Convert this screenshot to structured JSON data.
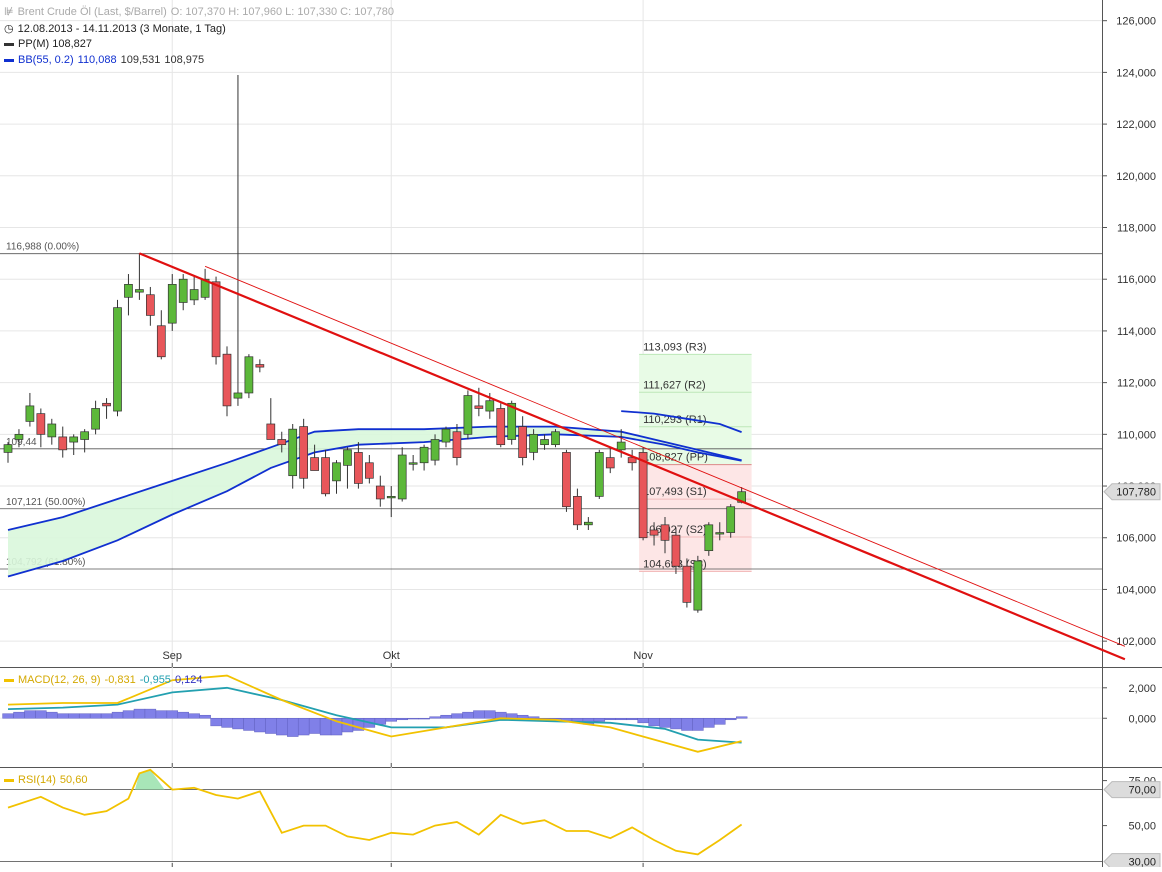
{
  "header": {
    "title": "Brent Crude Öl (Last, $/Barrel)",
    "ohlc": "O: 107,370  H: 107,960  L: 107,330  C: 107,780",
    "range": "12.08.2013 - 14.11.2013 (3 Monate, 1 Tag)",
    "pp_legend": "PP(M)  108,827",
    "bb_legend_name": "BB(55, 0.2)",
    "bb_legend_values": [
      "110,088",
      "109,531",
      "108,975"
    ]
  },
  "colors": {
    "up": "#5cb83a",
    "down": "#e8565a",
    "trend": "#e01010",
    "bb": "#1030d0",
    "bb_fill": "#d9f7dc",
    "macd": "#f2c200",
    "signal": "#23a0b0",
    "hist": "#8080e8",
    "rsi": "#f2c200",
    "pivot_r_fill": "#e8fbe6",
    "pivot_s_fill": "#fde6e6",
    "last_price_box": "#dcdcdc"
  },
  "chart_data": [
    {
      "type": "candlestick",
      "name": "Brent Crude Öl",
      "x_labels": [
        "Sep",
        "Okt",
        "Nov"
      ],
      "x_label_positions": [
        15,
        35,
        58
      ],
      "ylim": [
        101,
        126.8
      ],
      "y_ticks": [
        102,
        104,
        106,
        108,
        110,
        112,
        114,
        116,
        118,
        120,
        122,
        124,
        126
      ],
      "y_tick_labels": [
        "102,000",
        "104,000",
        "106,000",
        "108,000",
        "110,000",
        "112,000",
        "114,000",
        "116,000",
        "118,000",
        "120,000",
        "122,000",
        "124,000",
        "126,000"
      ],
      "last_price": 107.78,
      "last_price_label": "107,780",
      "candles": [
        {
          "i": 0,
          "o": 109.3,
          "h": 109.7,
          "l": 108.9,
          "c": 109.6
        },
        {
          "i": 1,
          "o": 109.8,
          "h": 110.2,
          "l": 109.5,
          "c": 110.0
        },
        {
          "i": 2,
          "o": 110.5,
          "h": 111.6,
          "l": 110.3,
          "c": 111.1
        },
        {
          "i": 3,
          "o": 110.8,
          "h": 111.0,
          "l": 109.5,
          "c": 110.0
        },
        {
          "i": 4,
          "o": 109.9,
          "h": 110.6,
          "l": 109.6,
          "c": 110.4
        },
        {
          "i": 5,
          "o": 109.9,
          "h": 110.3,
          "l": 109.1,
          "c": 109.4
        },
        {
          "i": 6,
          "o": 109.7,
          "h": 110.0,
          "l": 109.2,
          "c": 109.9
        },
        {
          "i": 7,
          "o": 109.8,
          "h": 110.2,
          "l": 109.3,
          "c": 110.1
        },
        {
          "i": 8,
          "o": 110.2,
          "h": 111.3,
          "l": 110.0,
          "c": 111.0
        },
        {
          "i": 9,
          "o": 111.2,
          "h": 111.4,
          "l": 110.6,
          "c": 111.1
        },
        {
          "i": 10,
          "o": 110.9,
          "h": 115.2,
          "l": 110.7,
          "c": 114.9
        },
        {
          "i": 11,
          "o": 115.3,
          "h": 116.2,
          "l": 114.6,
          "c": 115.8
        },
        {
          "i": 12,
          "o": 115.5,
          "h": 117.0,
          "l": 115.2,
          "c": 115.6
        },
        {
          "i": 13,
          "o": 115.4,
          "h": 115.7,
          "l": 114.2,
          "c": 114.6
        },
        {
          "i": 14,
          "o": 114.2,
          "h": 114.8,
          "l": 112.9,
          "c": 113.0
        },
        {
          "i": 15,
          "o": 114.3,
          "h": 116.2,
          "l": 114.0,
          "c": 115.8
        },
        {
          "i": 16,
          "o": 115.1,
          "h": 116.2,
          "l": 114.8,
          "c": 116.0
        },
        {
          "i": 17,
          "o": 115.2,
          "h": 116.1,
          "l": 115.0,
          "c": 115.6
        },
        {
          "i": 18,
          "o": 115.3,
          "h": 116.4,
          "l": 115.2,
          "c": 116.0
        },
        {
          "i": 19,
          "o": 115.9,
          "h": 116.1,
          "l": 112.7,
          "c": 113.0
        },
        {
          "i": 20,
          "o": 113.1,
          "h": 113.4,
          "l": 110.7,
          "c": 111.1
        },
        {
          "i": 21,
          "o": 111.4,
          "h": 123.9,
          "l": 111.1,
          "c": 111.6
        },
        {
          "i": 22,
          "o": 111.6,
          "h": 113.1,
          "l": 111.4,
          "c": 113.0
        },
        {
          "i": 23,
          "o": 112.7,
          "h": 112.9,
          "l": 112.4,
          "c": 112.6
        },
        {
          "i": 24,
          "o": 110.4,
          "h": 111.4,
          "l": 109.8,
          "c": 109.8
        },
        {
          "i": 25,
          "o": 109.8,
          "h": 110.1,
          "l": 109.3,
          "c": 109.6
        },
        {
          "i": 26,
          "o": 108.4,
          "h": 110.4,
          "l": 107.9,
          "c": 110.2
        },
        {
          "i": 27,
          "o": 110.3,
          "h": 110.6,
          "l": 107.9,
          "c": 108.3
        },
        {
          "i": 28,
          "o": 109.1,
          "h": 109.6,
          "l": 108.6,
          "c": 108.6
        },
        {
          "i": 29,
          "o": 109.1,
          "h": 109.4,
          "l": 107.6,
          "c": 107.7
        },
        {
          "i": 30,
          "o": 108.2,
          "h": 109.0,
          "l": 107.7,
          "c": 108.9
        },
        {
          "i": 31,
          "o": 108.8,
          "h": 109.5,
          "l": 107.9,
          "c": 109.4
        },
        {
          "i": 32,
          "o": 109.3,
          "h": 109.7,
          "l": 107.9,
          "c": 108.1
        },
        {
          "i": 33,
          "o": 108.9,
          "h": 109.2,
          "l": 108.1,
          "c": 108.3
        },
        {
          "i": 34,
          "o": 108.0,
          "h": 108.4,
          "l": 107.2,
          "c": 107.5
        },
        {
          "i": 35,
          "o": 107.6,
          "h": 108.0,
          "l": 106.8,
          "c": 107.6
        },
        {
          "i": 36,
          "o": 107.5,
          "h": 109.5,
          "l": 107.4,
          "c": 109.2
        },
        {
          "i": 37,
          "o": 108.9,
          "h": 109.2,
          "l": 108.6,
          "c": 108.9
        },
        {
          "i": 38,
          "o": 108.9,
          "h": 109.6,
          "l": 108.6,
          "c": 109.5
        },
        {
          "i": 39,
          "o": 109.0,
          "h": 110.0,
          "l": 108.8,
          "c": 109.8
        },
        {
          "i": 40,
          "o": 109.7,
          "h": 110.3,
          "l": 109.5,
          "c": 110.2
        },
        {
          "i": 41,
          "o": 110.1,
          "h": 110.4,
          "l": 108.8,
          "c": 109.1
        },
        {
          "i": 42,
          "o": 110.0,
          "h": 111.7,
          "l": 109.8,
          "c": 111.5
        },
        {
          "i": 43,
          "o": 111.1,
          "h": 111.8,
          "l": 110.7,
          "c": 111.0
        },
        {
          "i": 44,
          "o": 110.9,
          "h": 111.6,
          "l": 110.6,
          "c": 111.3
        },
        {
          "i": 45,
          "o": 111.0,
          "h": 111.2,
          "l": 109.5,
          "c": 109.6
        },
        {
          "i": 46,
          "o": 109.8,
          "h": 111.3,
          "l": 109.6,
          "c": 111.2
        },
        {
          "i": 47,
          "o": 110.3,
          "h": 110.7,
          "l": 108.8,
          "c": 109.1
        },
        {
          "i": 48,
          "o": 109.3,
          "h": 110.2,
          "l": 109.0,
          "c": 110.0
        },
        {
          "i": 49,
          "o": 109.6,
          "h": 110.0,
          "l": 109.4,
          "c": 109.8
        },
        {
          "i": 50,
          "o": 109.6,
          "h": 110.2,
          "l": 109.5,
          "c": 110.1
        },
        {
          "i": 51,
          "o": 109.3,
          "h": 109.4,
          "l": 107.0,
          "c": 107.2
        },
        {
          "i": 52,
          "o": 107.6,
          "h": 107.9,
          "l": 106.3,
          "c": 106.5
        },
        {
          "i": 53,
          "o": 106.5,
          "h": 106.8,
          "l": 106.3,
          "c": 106.6
        },
        {
          "i": 54,
          "o": 107.6,
          "h": 109.4,
          "l": 107.5,
          "c": 109.3
        },
        {
          "i": 55,
          "o": 109.1,
          "h": 109.5,
          "l": 108.5,
          "c": 108.7
        },
        {
          "i": 56,
          "o": 109.4,
          "h": 110.2,
          "l": 109.1,
          "c": 109.7
        },
        {
          "i": 57,
          "o": 109.1,
          "h": 109.4,
          "l": 108.6,
          "c": 108.9
        },
        {
          "i": 58,
          "o": 109.3,
          "h": 109.5,
          "l": 105.9,
          "c": 106.0
        },
        {
          "i": 59,
          "o": 106.3,
          "h": 106.6,
          "l": 105.7,
          "c": 106.1
        },
        {
          "i": 60,
          "o": 106.5,
          "h": 106.8,
          "l": 105.4,
          "c": 105.9
        },
        {
          "i": 61,
          "o": 106.1,
          "h": 106.4,
          "l": 104.6,
          "c": 104.9
        },
        {
          "i": 62,
          "o": 104.9,
          "h": 105.2,
          "l": 103.3,
          "c": 103.5
        },
        {
          "i": 63,
          "o": 103.2,
          "h": 105.3,
          "l": 103.1,
          "c": 105.1
        },
        {
          "i": 64,
          "o": 105.5,
          "h": 106.6,
          "l": 105.3,
          "c": 106.5
        },
        {
          "i": 65,
          "o": 106.2,
          "h": 106.6,
          "l": 105.9,
          "c": 106.2
        },
        {
          "i": 66,
          "o": 106.2,
          "h": 107.3,
          "l": 106.0,
          "c": 107.2
        },
        {
          "i": 67,
          "o": 107.37,
          "h": 107.96,
          "l": 107.33,
          "c": 107.78
        }
      ],
      "bollinger": {
        "upper": [
          [
            0,
            106.3
          ],
          [
            5,
            106.8
          ],
          [
            10,
            107.5
          ],
          [
            15,
            108.2
          ],
          [
            20,
            108.9
          ],
          [
            24,
            109.5
          ],
          [
            28,
            110.1
          ],
          [
            32,
            110.2
          ],
          [
            38,
            110.2
          ],
          [
            44,
            110.3
          ],
          [
            50,
            110.3
          ],
          [
            56,
            110.1
          ],
          [
            62,
            109.5
          ],
          [
            67,
            109.0
          ]
        ],
        "lower": [
          [
            0,
            104.5
          ],
          [
            5,
            105.1
          ],
          [
            10,
            105.9
          ],
          [
            15,
            106.9
          ],
          [
            20,
            107.8
          ],
          [
            24,
            108.7
          ],
          [
            28,
            109.3
          ],
          [
            32,
            109.6
          ],
          [
            38,
            109.7
          ],
          [
            44,
            109.9
          ],
          [
            50,
            110.0
          ],
          [
            56,
            109.9
          ],
          [
            60,
            109.6
          ],
          [
            63,
            109.3
          ],
          [
            67,
            108.975
          ]
        ],
        "upper_ext": [
          [
            56,
            110.9
          ],
          [
            59,
            110.8
          ],
          [
            62,
            110.6
          ],
          [
            65,
            110.4
          ],
          [
            67,
            110.088
          ]
        ]
      },
      "trendlines": [
        {
          "from": [
            12,
            117.0
          ],
          "to": [
            102,
            101.3
          ],
          "width": 2.2
        },
        {
          "from": [
            18,
            116.5
          ],
          "to": [
            102,
            101.8
          ],
          "width": 0.9
        }
      ],
      "fibonacci": [
        {
          "value": 116.988,
          "label": "116,988 (0.00%)"
        },
        {
          "value": 109.44,
          "label": "109,44"
        },
        {
          "value": 107.121,
          "label": "107,121 (50.00%)"
        },
        {
          "value": 104.792,
          "label": "104,792 (61.80%)"
        }
      ],
      "pivots": [
        {
          "value": 113.093,
          "label": "113,093 (R3)"
        },
        {
          "value": 111.627,
          "label": "111,627 (R2)"
        },
        {
          "value": 110.293,
          "label": "110,293 (R1)"
        },
        {
          "value": 108.827,
          "label": "108,827 (PP)"
        },
        {
          "value": 107.493,
          "label": "107,493 (S1)"
        },
        {
          "value": 106.027,
          "label": "106,027 (S2)"
        },
        {
          "value": 104.693,
          "label": "104,693 (S3)"
        }
      ]
    },
    {
      "type": "macd",
      "legend": "MACD(12, 26, 9)",
      "legend_values": [
        "-0,831",
        "-0,955",
        "0,124"
      ],
      "ylim": [
        -3.2,
        3.3
      ],
      "y_ticks": [
        0,
        2
      ],
      "y_tick_labels": [
        "0,000",
        "2,000"
      ],
      "macd": [
        [
          0,
          0.9
        ],
        [
          5,
          1.0
        ],
        [
          10,
          1.0
        ],
        [
          15,
          2.5
        ],
        [
          20,
          2.8
        ],
        [
          25,
          1.2
        ],
        [
          30,
          -0.2
        ],
        [
          35,
          -1.2
        ],
        [
          40,
          -0.6
        ],
        [
          45,
          0.0
        ],
        [
          50,
          -0.1
        ],
        [
          55,
          -0.6
        ],
        [
          60,
          -1.6
        ],
        [
          63,
          -2.2
        ],
        [
          67,
          -1.5
        ]
      ],
      "signal": [
        [
          0,
          0.6
        ],
        [
          5,
          0.7
        ],
        [
          10,
          0.9
        ],
        [
          15,
          1.7
        ],
        [
          20,
          2.0
        ],
        [
          25,
          1.2
        ],
        [
          30,
          0.2
        ],
        [
          35,
          -0.6
        ],
        [
          40,
          -0.6
        ],
        [
          45,
          -0.1
        ],
        [
          50,
          -0.2
        ],
        [
          55,
          -0.3
        ],
        [
          60,
          -0.7
        ],
        [
          63,
          -1.4
        ],
        [
          67,
          -1.6
        ]
      ],
      "hist": [
        0.3,
        0.4,
        0.5,
        0.5,
        0.4,
        0.3,
        0.3,
        0.3,
        0.3,
        0.3,
        0.4,
        0.5,
        0.6,
        0.6,
        0.5,
        0.5,
        0.4,
        0.3,
        0.2,
        -0.5,
        -0.6,
        -0.7,
        -0.8,
        -0.9,
        -1.0,
        -1.1,
        -1.2,
        -1.1,
        -1.0,
        -1.1,
        -1.1,
        -0.9,
        -0.8,
        -0.6,
        -0.4,
        -0.2,
        -0.1,
        0.0,
        0.0,
        0.1,
        0.2,
        0.3,
        0.4,
        0.5,
        0.5,
        0.4,
        0.3,
        0.2,
        0.1,
        0.0,
        0.0,
        -0.2,
        -0.3,
        -0.4,
        -0.2,
        -0.1,
        -0.1,
        -0.1,
        -0.3,
        -0.5,
        -0.6,
        -0.7,
        -0.8,
        -0.8,
        -0.6,
        -0.4,
        -0.1,
        0.1
      ]
    },
    {
      "type": "rsi",
      "legend": "RSI(14)",
      "legend_value": "50,60",
      "ylim": [
        27,
        82
      ],
      "y_ticks": [
        50,
        75
      ],
      "y_tick_labels": [
        "50,00",
        "75,00"
      ],
      "levels": [
        {
          "value": 70,
          "label": "70,00"
        },
        {
          "value": 30,
          "label": "30,00"
        }
      ],
      "rsi": [
        [
          0,
          60
        ],
        [
          3,
          66
        ],
        [
          5,
          60
        ],
        [
          7,
          56
        ],
        [
          9,
          58
        ],
        [
          11,
          65
        ],
        [
          12,
          79
        ],
        [
          13,
          81
        ],
        [
          15,
          70
        ],
        [
          17,
          71
        ],
        [
          19,
          67
        ],
        [
          21,
          65
        ],
        [
          23,
          69
        ],
        [
          25,
          46
        ],
        [
          27,
          50
        ],
        [
          29,
          50
        ],
        [
          31,
          44
        ],
        [
          33,
          42
        ],
        [
          35,
          46
        ],
        [
          37,
          45
        ],
        [
          39,
          50
        ],
        [
          41,
          52
        ],
        [
          43,
          45
        ],
        [
          45,
          56
        ],
        [
          47,
          51
        ],
        [
          49,
          53
        ],
        [
          51,
          47
        ],
        [
          53,
          47
        ],
        [
          55,
          43
        ],
        [
          57,
          49
        ],
        [
          59,
          42
        ],
        [
          61,
          36
        ],
        [
          63,
          34
        ],
        [
          65,
          42
        ],
        [
          67,
          50.6
        ]
      ]
    }
  ]
}
